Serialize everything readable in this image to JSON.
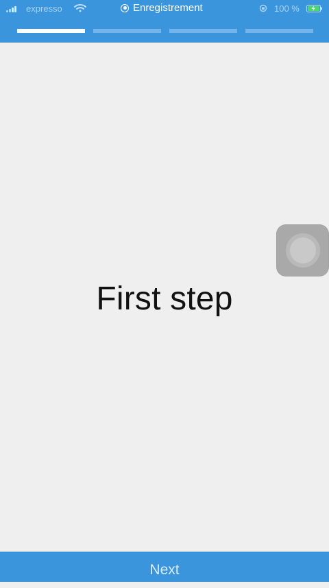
{
  "status_bar": {
    "carrier": "expresso",
    "recording_label": "Enregistrement",
    "battery_percent": "100 %"
  },
  "progress": {
    "total_steps": 4,
    "current_step": 1
  },
  "main": {
    "title": "First step"
  },
  "footer": {
    "next_label": "Next"
  },
  "icons": {
    "signal": "signal-bars-icon",
    "wifi": "wifi-icon",
    "record": "record-dot-icon",
    "rotation_lock": "rotation-lock-icon",
    "battery": "battery-charging-icon",
    "assistive": "assistive-touch-icon"
  },
  "colors": {
    "header_blue": "#3a95dc",
    "segment_active": "#ffffff",
    "segment_inactive": "#73b5ea",
    "background": "#efefef"
  }
}
